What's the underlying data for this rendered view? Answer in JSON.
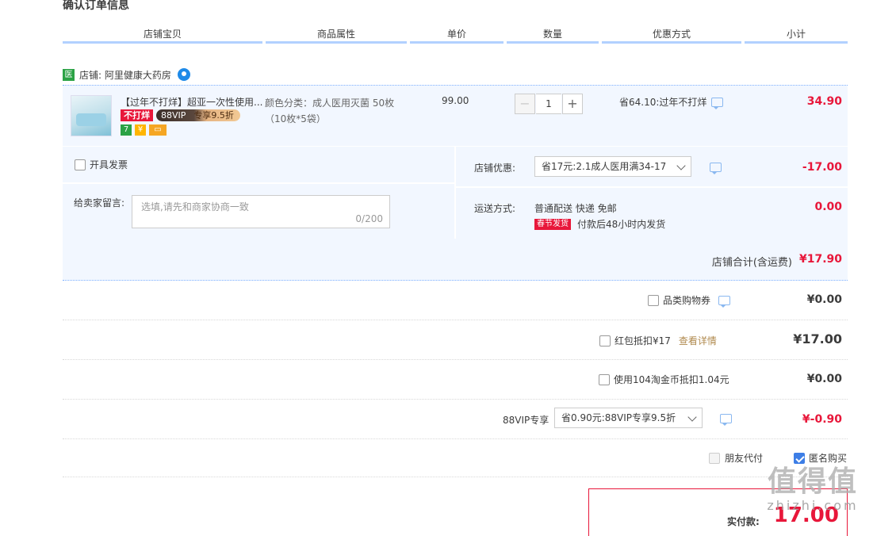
{
  "section_title": "确认订单信息",
  "columns": [
    "店铺宝贝",
    "商品属性",
    "单价",
    "数量",
    "优惠方式",
    "小计"
  ],
  "shop": {
    "badge": "医",
    "label": "店铺: 阿里健康大药房"
  },
  "item": {
    "title": "【过年不打烊】超亚一次性使用...",
    "badge_red": "不打烊",
    "badge_vip_name": "88VIP",
    "badge_vip_offer": "专享9.5折",
    "mini_icons": [
      "7",
      "¥",
      "▭"
    ],
    "attr_line1": "颜色分类：成人医用灭菌 50枚",
    "attr_line2": "（10枚*5袋）",
    "unit_price": "99.00",
    "qty_minus": "−",
    "qty_value": "1",
    "qty_plus": "+",
    "promo": "省64.10:过年不打烊",
    "subtotal": "34.90"
  },
  "options": {
    "invoice_label": "开具发票",
    "message_label": "给卖家留言:",
    "message_placeholder": "选填,请先和商家协商一致",
    "message_count": "0/200",
    "shop_discount_label": "店铺优惠:",
    "shop_discount_select": "省17元:2.1成人医用满34-17",
    "shop_discount_value": "-17.00",
    "shipping_label": "运送方式:",
    "shipping_text": "普通配送 快递 免邮",
    "shipping_badge": "春节发货",
    "shipping_note": "付款后48小时内发货",
    "shipping_value": "0.00"
  },
  "shop_total": {
    "label": "店铺合计(含运费)",
    "value": "¥17.90"
  },
  "rows": {
    "category_coupon": {
      "label": "品类购物券",
      "value": "¥0.00"
    },
    "red_packet": {
      "label": "红包抵扣¥17",
      "link": "查看详情",
      "value": "¥17.00"
    },
    "taobao_coin": {
      "label": "使用104淘金币抵扣1.04元",
      "value": "¥0.00"
    },
    "vip": {
      "label": "88VIP专享",
      "select": "省0.90元:88VIP专享9.5折",
      "value": "¥-0.90"
    }
  },
  "bottom": {
    "friend_pay": "朋友代付",
    "anonymous": "匿名购买"
  },
  "pay": {
    "label": "实付款:",
    "value": "17.00"
  },
  "watermark": {
    "top": "值得值",
    "bottom": "zhizhi.com"
  },
  "colors": {
    "accent": "#3d7ee6",
    "price_red": "#e8173a",
    "panel_bg": "#f2f7ff"
  }
}
